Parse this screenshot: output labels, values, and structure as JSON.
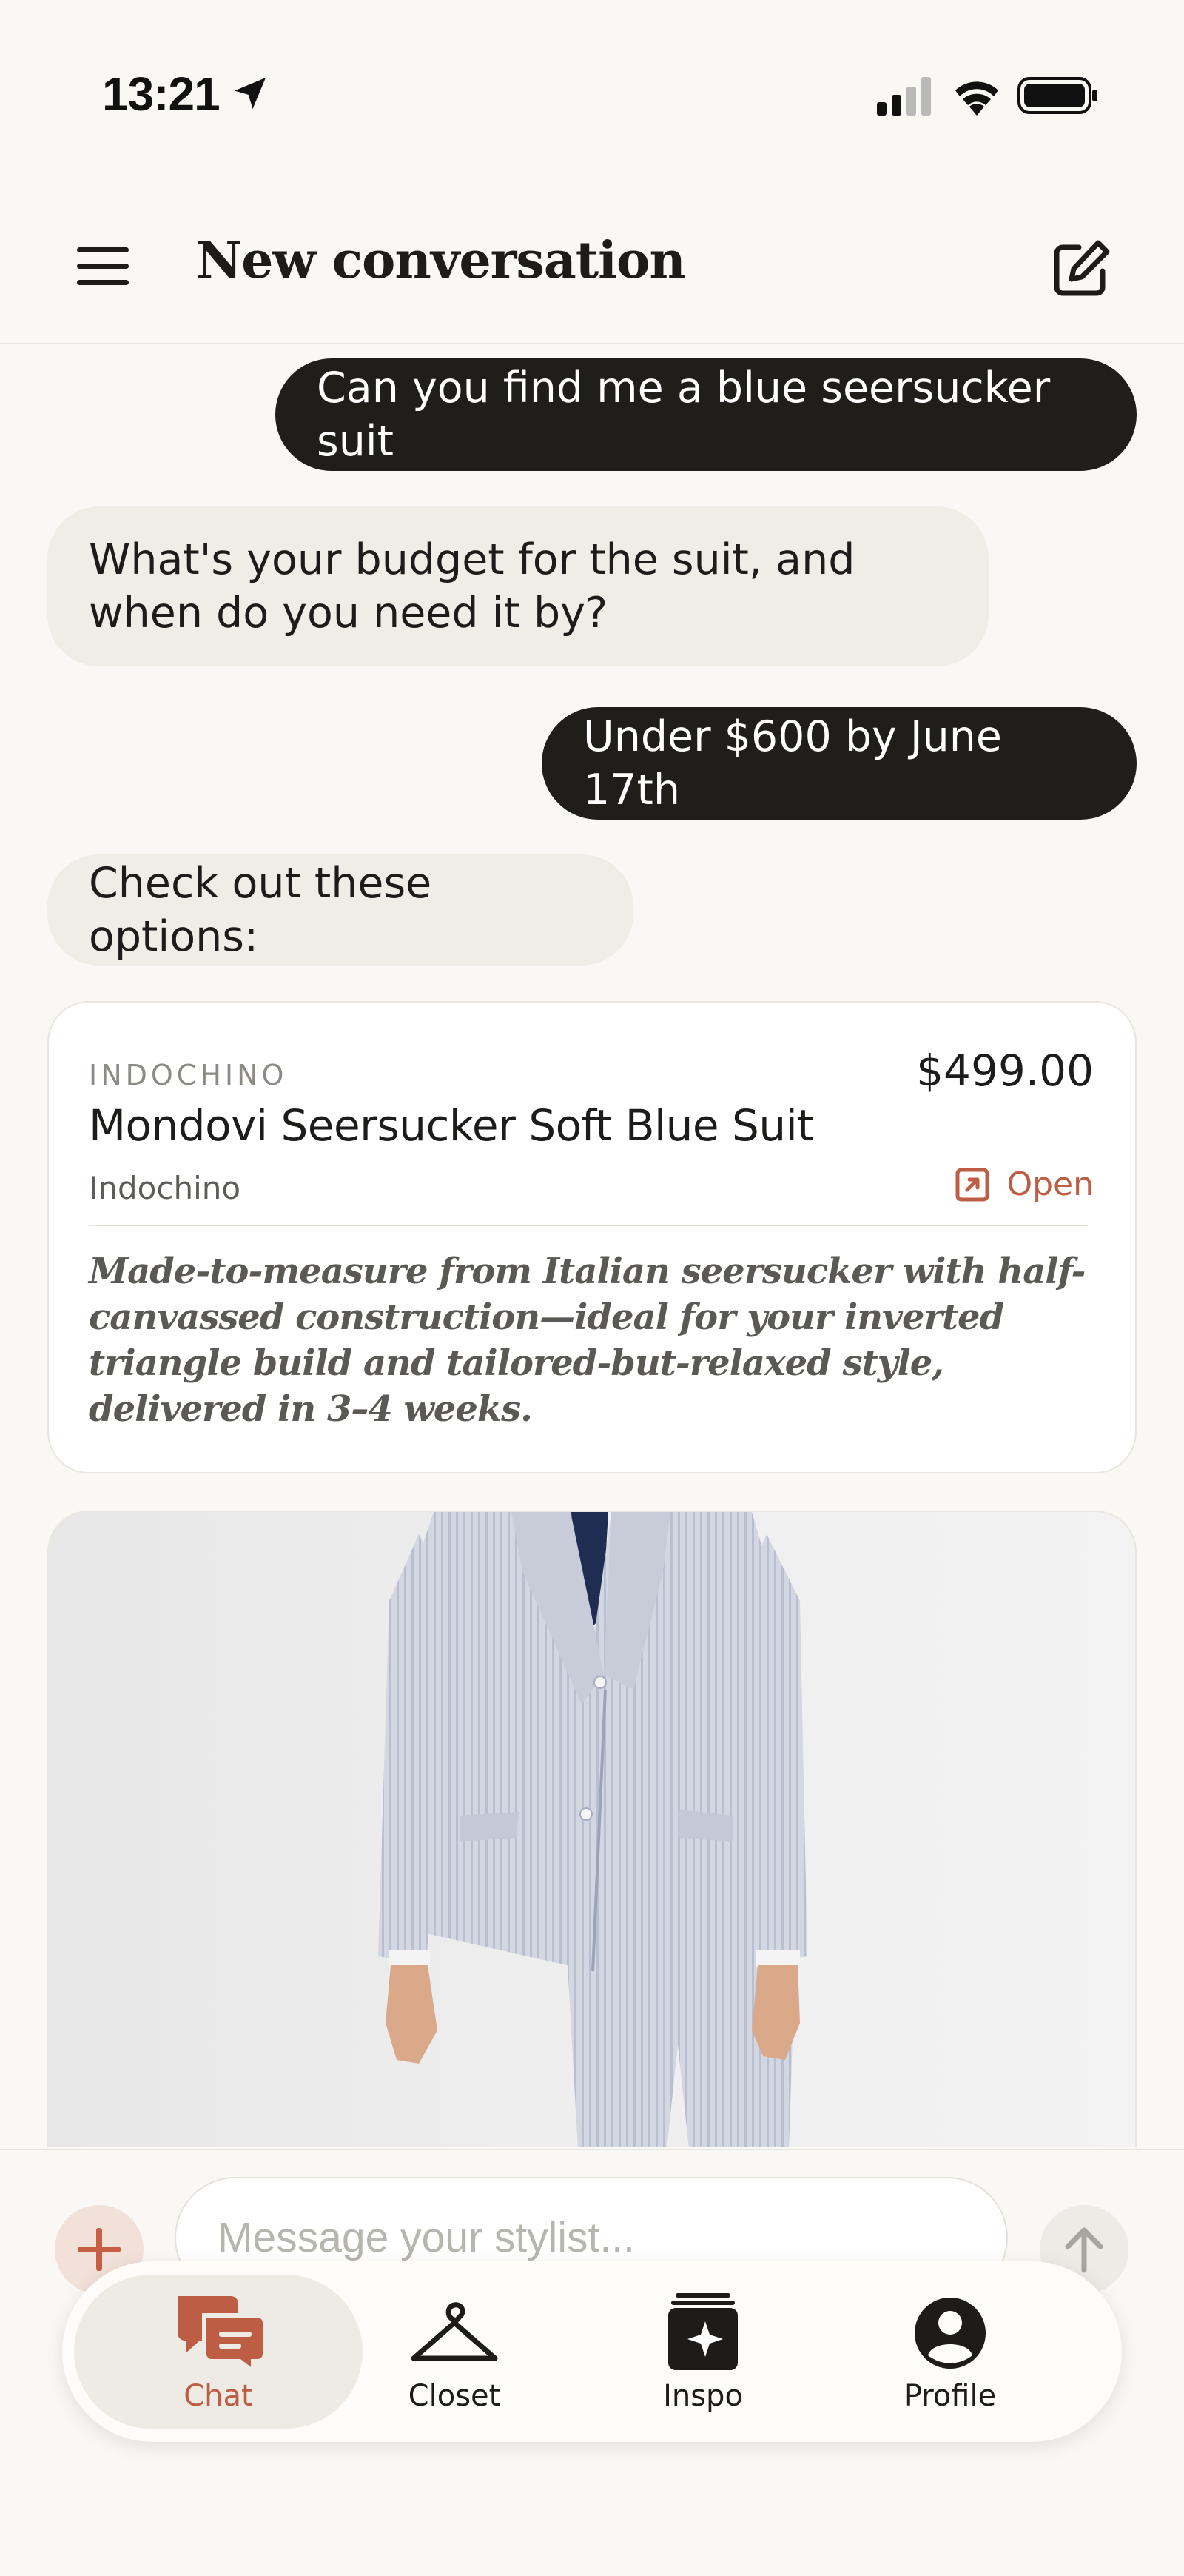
{
  "status_bar": {
    "time": "13:21"
  },
  "header": {
    "title": "New conversation"
  },
  "messages": [
    {
      "role": "user",
      "text": "Can you find me a blue seersucker suit"
    },
    {
      "role": "assistant",
      "text": "What's your budget for the suit, and when do you need it by?"
    },
    {
      "role": "user",
      "text": "Under $600 by June 17th"
    },
    {
      "role": "assistant",
      "text": "Check out these options:"
    }
  ],
  "product": {
    "brand_caps": "INDOCHINO",
    "price": "$499.00",
    "name": "Mondovi Seersucker Soft Blue Suit",
    "store": "Indochino",
    "open_label": "Open",
    "description": "Made-to-measure from Italian seersucker with half-canvassed construction—ideal for your inverted triangle build and tailored-but-relaxed style, delivered in 3–4 weeks.",
    "image_icon": "seersucker-suit-photo"
  },
  "composer": {
    "placeholder": "Message your stylist...",
    "value": ""
  },
  "tabs": [
    {
      "label": "Chat",
      "icon": "chat-bubbles-icon",
      "active": true
    },
    {
      "label": "Closet",
      "icon": "hanger-icon",
      "active": false
    },
    {
      "label": "Inspo",
      "icon": "sparkle-cards-icon",
      "active": false
    },
    {
      "label": "Profile",
      "icon": "person-icon",
      "active": false
    }
  ],
  "colors": {
    "background": "#f9f8f4",
    "user_bubble": "#1f1e1b",
    "assistant_bubble": "#efede6",
    "accent": "#bd5d43",
    "text": "#1d1c1a"
  }
}
